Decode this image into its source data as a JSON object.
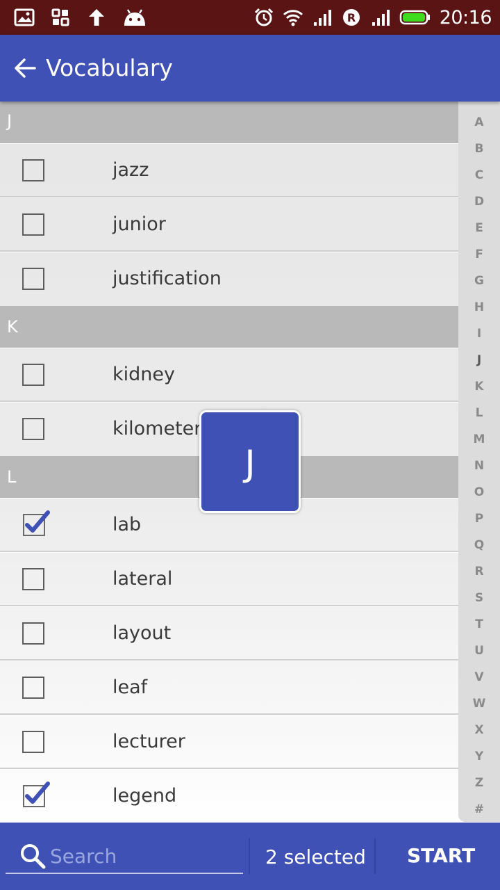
{
  "status_bar": {
    "time": "20:16",
    "left_icons": [
      "image-icon",
      "apps-icon",
      "upload-arrow-icon",
      "android-icon"
    ],
    "right_icons": [
      "alarm-icon",
      "wifi-icon",
      "signal-icon",
      "roaming-r-icon",
      "signal-icon",
      "battery-icon"
    ],
    "background": "#5a1414",
    "battery_color": "#3ddc1f"
  },
  "app_bar": {
    "title": "Vocabulary",
    "back_icon": "arrow-back-icon",
    "color": "#3f51b5"
  },
  "sections": [
    {
      "letter": "J",
      "items": [
        {
          "word": "jazz",
          "checked": false
        },
        {
          "word": "junior",
          "checked": false
        },
        {
          "word": "justification",
          "checked": false
        }
      ]
    },
    {
      "letter": "K",
      "items": [
        {
          "word": "kidney",
          "checked": false
        },
        {
          "word": "kilometer",
          "checked": false
        }
      ]
    },
    {
      "letter": "L",
      "items": [
        {
          "word": "lab",
          "checked": true
        },
        {
          "word": "lateral",
          "checked": false
        },
        {
          "word": "layout",
          "checked": false
        },
        {
          "word": "leaf",
          "checked": false
        },
        {
          "word": "lecturer",
          "checked": false
        },
        {
          "word": "legend",
          "checked": true
        }
      ]
    }
  ],
  "index_letters": [
    "A",
    "B",
    "C",
    "D",
    "E",
    "F",
    "G",
    "H",
    "I",
    "J",
    "K",
    "L",
    "M",
    "N",
    "O",
    "P",
    "Q",
    "R",
    "S",
    "T",
    "U",
    "V",
    "W",
    "X",
    "Y",
    "Z",
    "#"
  ],
  "active_index": "J",
  "popup_letter": "J",
  "bottom_bar": {
    "search_placeholder": "Search",
    "selected_text": "2 selected",
    "start_label": "START"
  }
}
